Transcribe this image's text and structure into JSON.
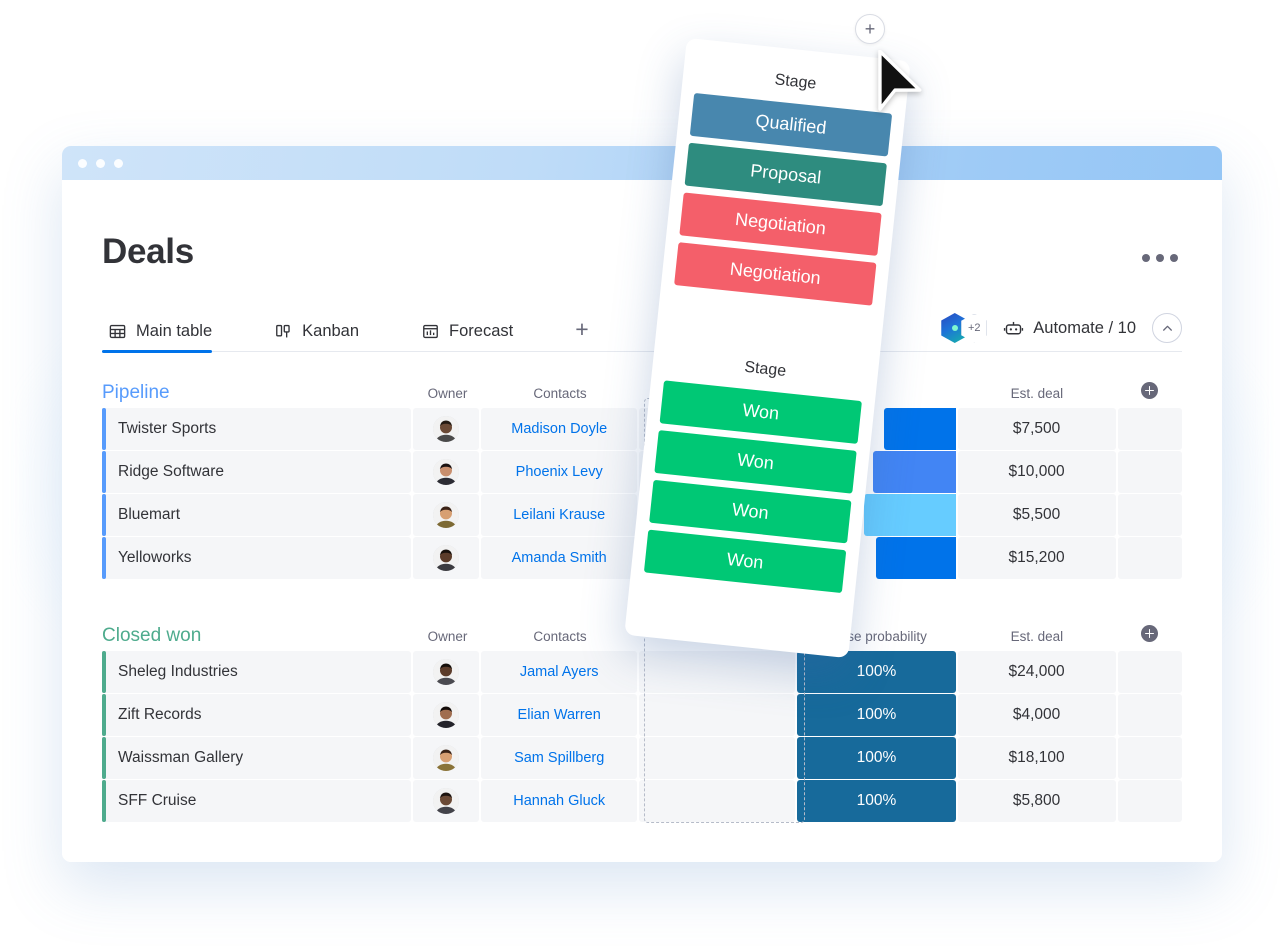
{
  "window": {
    "traffic_lights": 3
  },
  "header": {
    "title": "Deals",
    "kebab_label": "More options"
  },
  "tabs": [
    {
      "label": "Main table",
      "icon": "grid-icon",
      "active": true
    },
    {
      "label": "Kanban",
      "icon": "kanban-icon",
      "active": false
    },
    {
      "label": "Forecast",
      "icon": "chart-icon",
      "active": false
    }
  ],
  "tabs_add_label": "+",
  "toolbar": {
    "integrations_badge": "+2",
    "automate_label": "Automate / 10",
    "automate_icon": "robot-icon",
    "collapse_icon": "chevron-up-icon"
  },
  "columns": {
    "owner": "Owner",
    "contacts": "Contacts",
    "close_probability": "Close probability",
    "est_deal": "Est. deal",
    "add_column": "+"
  },
  "groups": [
    {
      "name": "Pipeline",
      "color": "#579bfc",
      "title_color": "#579bfc",
      "rows": [
        {
          "name": "Twister Sports",
          "contact": "Madison Doyle",
          "probability": "",
          "prob_color": "#0073ea",
          "prob_fill": 45,
          "deal": "$7,500",
          "avatar_skin": "#6b4a36",
          "avatar_hair": "#241a13",
          "avatar_shirt": "#4a4a4a"
        },
        {
          "name": "Ridge Software",
          "contact": "Phoenix Levy",
          "probability": "",
          "prob_color": "#4285f4",
          "prob_fill": 52,
          "deal": "$10,000",
          "avatar_skin": "#c98f6e",
          "avatar_hair": "#1a1110",
          "avatar_shirt": "#2c2c34"
        },
        {
          "name": "Bluemart",
          "contact": "Leilani Krause",
          "probability": "",
          "prob_color": "#66ccff",
          "prob_fill": 58,
          "deal": "$5,500",
          "avatar_skin": "#d79f72",
          "avatar_hair": "#3a2216",
          "avatar_shirt": "#7d6a34"
        },
        {
          "name": "Yelloworks",
          "contact": "Amanda Smith",
          "probability": "",
          "prob_color": "#0073ea",
          "prob_fill": 50,
          "deal": "$15,200",
          "avatar_skin": "#5b3c2a",
          "avatar_hair": "#17100b",
          "avatar_shirt": "#3b3b40"
        }
      ]
    },
    {
      "name": "Closed won",
      "color": "#4eab8d",
      "title_color": "#4eab8d",
      "rows": [
        {
          "name": "Sheleg Industries",
          "contact": "Jamal Ayers",
          "probability": "100%",
          "prob_color": "#176a9b",
          "prob_fill": 100,
          "deal": "$24,000",
          "avatar_skin": "#5d3d2b",
          "avatar_hair": "#160f0a",
          "avatar_shirt": "#4b4b51"
        },
        {
          "name": "Zift Records",
          "contact": "Elian Warren",
          "probability": "100%",
          "prob_color": "#176a9b",
          "prob_fill": 100,
          "deal": "$4,000",
          "avatar_skin": "#a06d4f",
          "avatar_hair": "#120b08",
          "avatar_shirt": "#23232a"
        },
        {
          "name": "Waissman Gallery",
          "contact": "Sam Spillberg",
          "probability": "100%",
          "prob_color": "#176a9b",
          "prob_fill": 100,
          "deal": "$18,100",
          "avatar_skin": "#d79f72",
          "avatar_hair": "#3a2216",
          "avatar_shirt": "#8a7338"
        },
        {
          "name": "SFF Cruise",
          "contact": "Hannah Gluck",
          "probability": "100%",
          "prob_color": "#176a9b",
          "prob_fill": 100,
          "deal": "$5,800",
          "avatar_skin": "#6b4a36",
          "avatar_hair": "#1d1410",
          "avatar_shirt": "#43434a"
        }
      ]
    }
  ],
  "drag_card": {
    "label_top": "Stage",
    "label_bottom": "Stage",
    "chips_top": [
      {
        "label": "Qualified",
        "color": "#4887ae"
      },
      {
        "label": "Proposal",
        "color": "#2e8c7f"
      },
      {
        "label": "Negotiation",
        "color": "#f45f6a"
      },
      {
        "label": "Negotiation",
        "color": "#f45f6a"
      }
    ],
    "chips_bottom": [
      {
        "label": "Won",
        "color": "#00c875"
      },
      {
        "label": "Won",
        "color": "#00c875"
      },
      {
        "label": "Won",
        "color": "#00c875"
      },
      {
        "label": "Won",
        "color": "#00c875"
      }
    ]
  },
  "overlay": {
    "add_button_label": "+",
    "cursor_icon": "cursor-arrow-icon",
    "drop_placeholder": "column-drop-placeholder"
  }
}
